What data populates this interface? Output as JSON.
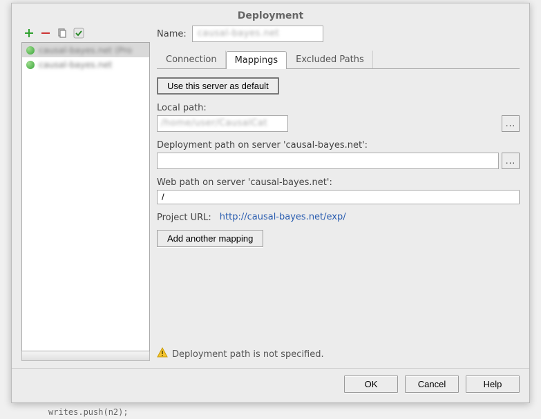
{
  "dialog": {
    "title": "Deployment",
    "name_label": "Name:",
    "name_value": "causal-bayes.net",
    "tabs": {
      "connection": "Connection",
      "mappings": "Mappings",
      "excluded": "Excluded Paths",
      "active": "mappings"
    },
    "set_default_label": "Use this server as default",
    "local_path_label": "Local path:",
    "local_path_value": "/home/user/CausalCat",
    "deploy_path_label": "Deployment path on server 'causal-bayes.net':",
    "deploy_path_value": "",
    "web_path_label": "Web path on server 'causal-bayes.net':",
    "web_path_value": "/",
    "project_url_label": "Project URL:",
    "project_url_value": "http://causal-bayes.net/exp/",
    "add_mapping_label": "Add another mapping",
    "warning_text": "Deployment path is not specified.",
    "ok": "OK",
    "cancel": "Cancel",
    "help": "Help"
  },
  "servers": [
    {
      "label": "causal-bayes.net (Pro",
      "selected": true
    },
    {
      "label": "causal-bayes.net",
      "selected": false
    }
  ],
  "icons": {
    "add": "add-icon",
    "remove": "remove-icon",
    "copy": "copy-icon",
    "default": "check-icon",
    "browse": "..."
  },
  "bg_code": "writes.push(n2);"
}
